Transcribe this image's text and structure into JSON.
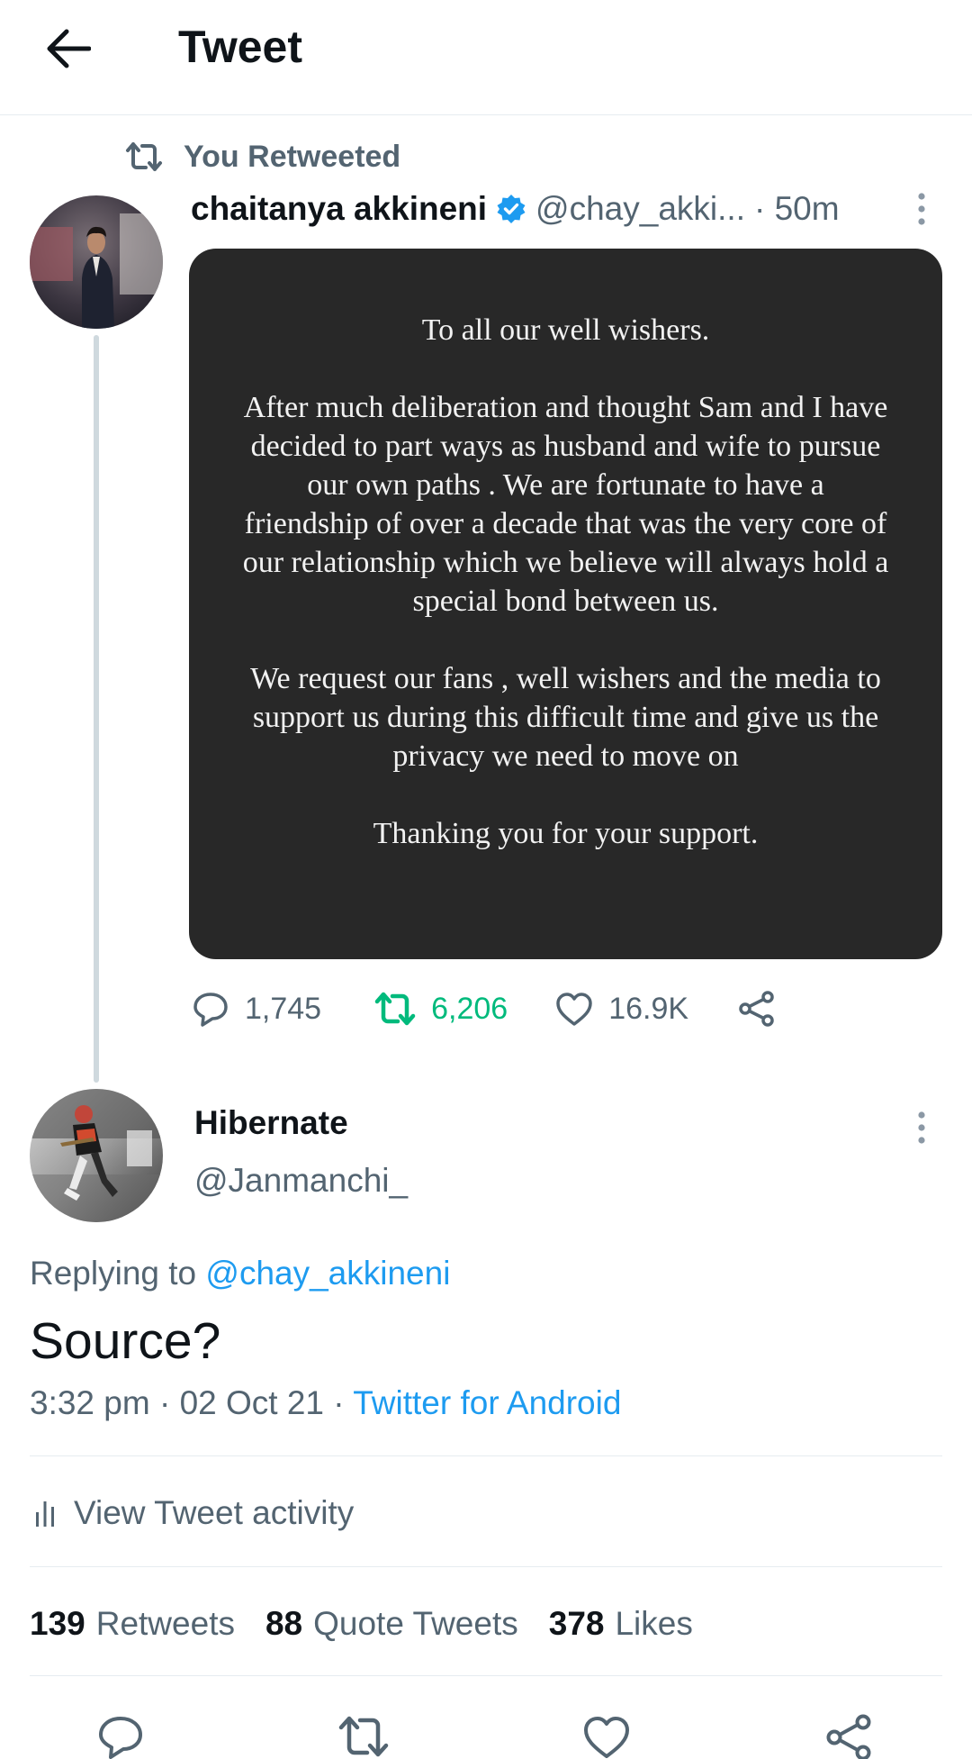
{
  "header": {
    "title": "Tweet"
  },
  "retweet_banner": {
    "label": "You Retweeted"
  },
  "original_tweet": {
    "author_name": "chaitanya akkineni",
    "handle": "@chay_akki...",
    "time": "· 50m",
    "statement": {
      "p1": "To all our well wishers.",
      "p2": "After much deliberation and thought Sam and I have decided to part ways as husband and wife to pursue our own paths . We are fortunate to have a friendship of over a decade that was the very core of our relationship which we believe will always hold a special bond between us.",
      "p3": "We request our fans , well wishers and the media to support us during this difficult time and give us the privacy we need to move on",
      "p4": "Thanking you for your support."
    },
    "replies": "1,745",
    "retweets": "6,206",
    "likes": "16.9K",
    "retweet_color": "#00ba7c"
  },
  "reply_tweet": {
    "author_name": "Hibernate",
    "handle": "@Janmanchi_",
    "replying_prefix": "Replying to",
    "replying_to": "@chay_akkineni",
    "text": "Source?",
    "timestamp": "3:32 pm · 02 Oct 21 ·",
    "source": "Twitter for Android",
    "activity_label": "View Tweet activity",
    "stats": {
      "retweets_count": "139",
      "retweets_label": "Retweets",
      "quotes_count": "88",
      "quotes_label": "Quote Tweets",
      "likes_count": "378",
      "likes_label": "Likes"
    }
  },
  "icons": [
    "back-arrow-icon",
    "retweet-icon",
    "verified-badge-icon",
    "more-vertical-icon",
    "reply-icon",
    "like-icon",
    "share-icon",
    "activity-chart-icon"
  ],
  "colors": {
    "link": "#1d9bf0",
    "secondary_text": "#536471",
    "verified": "#1d9bf0",
    "statement_bg": "#282828"
  }
}
